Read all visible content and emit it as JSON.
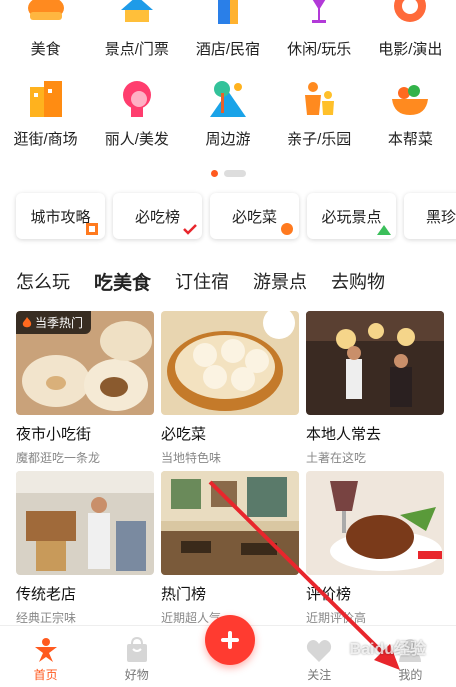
{
  "categories_row1": [
    {
      "label": "美食",
      "icon": "food-icon"
    },
    {
      "label": "景点/门票",
      "icon": "attraction-icon"
    },
    {
      "label": "酒店/民宿",
      "icon": "hotel-icon"
    },
    {
      "label": "休闲/玩乐",
      "icon": "leisure-icon"
    },
    {
      "label": "电影/演出",
      "icon": "movie-icon"
    }
  ],
  "categories_row2": [
    {
      "label": "逛街/商场",
      "icon": "mall-icon"
    },
    {
      "label": "丽人/美发",
      "icon": "beauty-icon"
    },
    {
      "label": "周边游",
      "icon": "nearby-travel-icon"
    },
    {
      "label": "亲子/乐园",
      "icon": "family-icon"
    },
    {
      "label": "本帮菜",
      "icon": "local-cuisine-icon"
    }
  ],
  "quick_chips": [
    "城市攻略",
    "必吃榜",
    "必吃菜",
    "必玩景点",
    "黑珍珠"
  ],
  "tabs": [
    "怎么玩",
    "吃美食",
    "订住宿",
    "游景点",
    "去购物"
  ],
  "active_tab": "吃美食",
  "cards": [
    {
      "title": "夜市小吃街",
      "subtitle": "魔都逛吃一条龙",
      "tag": "当季热门"
    },
    {
      "title": "必吃菜",
      "subtitle": "当地特色味"
    },
    {
      "title": "本地人常去",
      "subtitle": "土著在这吃"
    },
    {
      "title": "传统老店",
      "subtitle": "经典正宗味"
    },
    {
      "title": "热门榜",
      "subtitle": "近期超人气"
    },
    {
      "title": "评价榜",
      "subtitle": "近期评价高"
    }
  ],
  "bottom_nav": [
    {
      "label": "首页",
      "icon": "home-icon",
      "active": true
    },
    {
      "label": "好物",
      "icon": "shopping-bag-icon"
    },
    {
      "label": "",
      "icon": "plus-icon"
    },
    {
      "label": "关注",
      "icon": "heart-icon"
    },
    {
      "label": "我的",
      "icon": "profile-icon"
    }
  ],
  "watermark": "Baidu经验",
  "colors": {
    "accent": "#ff5a1f",
    "plus_button": "#ff3b30",
    "arrow": "#e8262c"
  }
}
